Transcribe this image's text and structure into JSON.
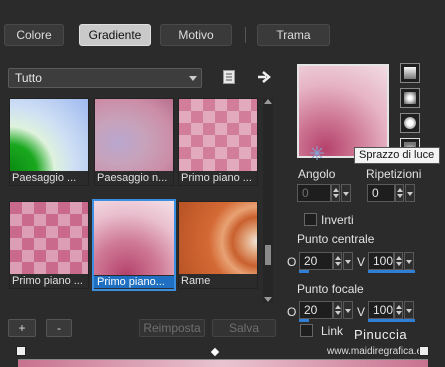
{
  "tabs": [
    {
      "label": "Colore",
      "active": false
    },
    {
      "label": "Gradiente",
      "active": true
    },
    {
      "label": "Motivo",
      "active": false
    },
    {
      "label": "Trama",
      "active": false
    }
  ],
  "category": {
    "selected": "Tutto"
  },
  "gradients": [
    {
      "caption": "Paesaggio ...",
      "selected": false
    },
    {
      "caption": "Paesaggio n...",
      "selected": false
    },
    {
      "caption": "Primo piano ...",
      "selected": false
    },
    {
      "caption": "Primo piano ...",
      "selected": false
    },
    {
      "caption": "Primo piano...",
      "selected": true
    },
    {
      "caption": "Rame",
      "selected": false
    }
  ],
  "buttons": {
    "add": "+",
    "remove": "-",
    "reset": "Reimposta",
    "save": "Salva"
  },
  "tooltip": "Sprazzo di luce",
  "angle": {
    "label": "Angolo",
    "value": "0"
  },
  "repeats": {
    "label": "Ripetizioni",
    "value": "0"
  },
  "invert": {
    "label": "Inverti",
    "checked": false
  },
  "center_point": {
    "label": "Punto centrale",
    "h_label": "O",
    "h_value": "20",
    "v_label": "V",
    "v_value": "100"
  },
  "focal_point": {
    "label": "Punto focale",
    "h_label": "O",
    "h_value": "20",
    "v_label": "V",
    "v_value": "100"
  },
  "link": {
    "label": "Link",
    "checked": false
  },
  "watermark": {
    "name": "Pinuccia",
    "url": "www.maidiregrafica.eu"
  },
  "colors": {
    "accent": "#3a8fe0",
    "pink": "#cf7a97",
    "dark": "#b5426b"
  }
}
